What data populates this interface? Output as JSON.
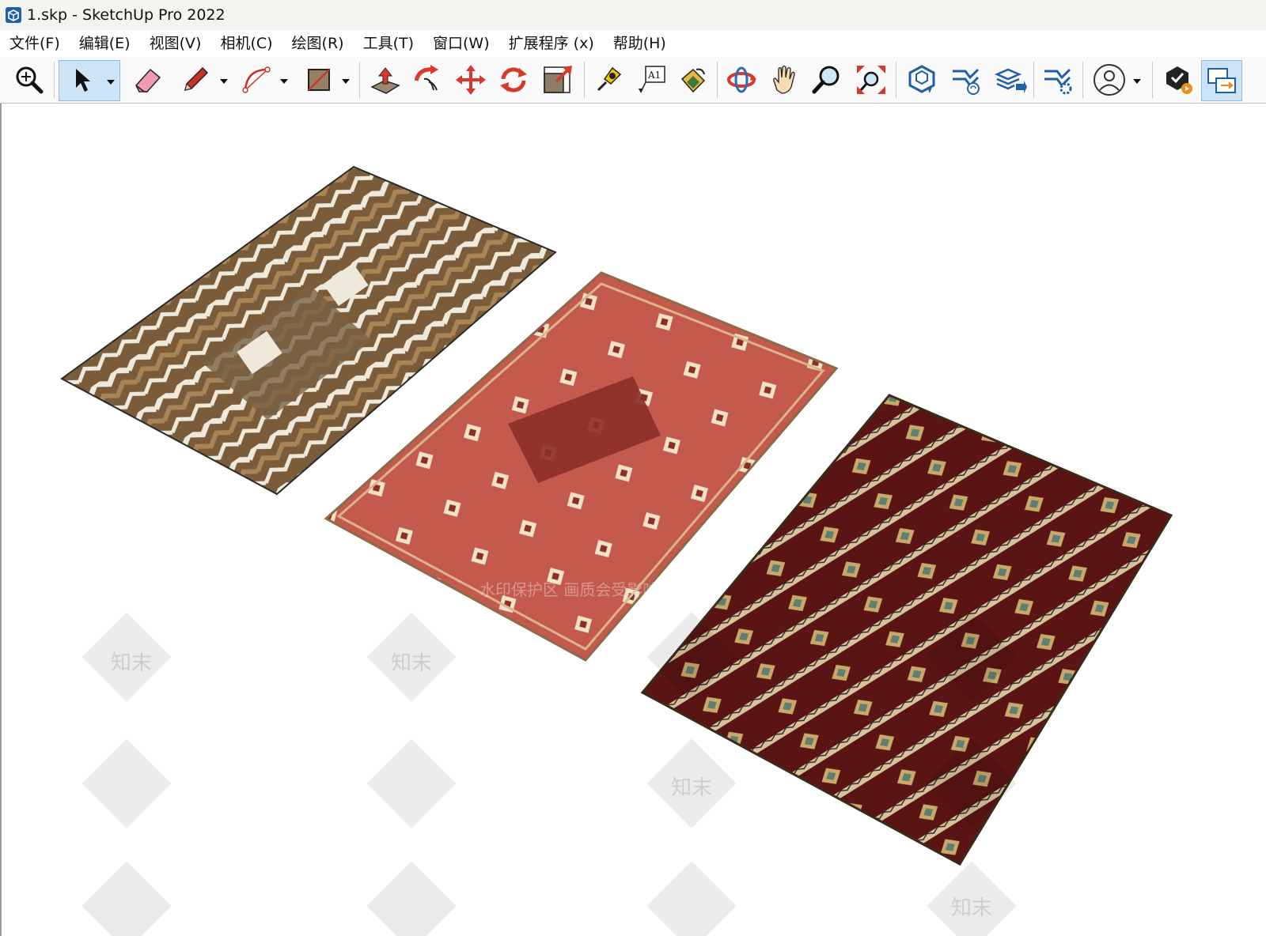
{
  "window": {
    "title": "1.skp - SketchUp Pro 2022"
  },
  "menubar": {
    "items": [
      {
        "label": "文件(F)"
      },
      {
        "label": "编辑(E)"
      },
      {
        "label": "视图(V)"
      },
      {
        "label": "相机(C)"
      },
      {
        "label": "绘图(R)"
      },
      {
        "label": "工具(T)"
      },
      {
        "label": "窗口(W)"
      },
      {
        "label": "扩展程序 (x)"
      },
      {
        "label": "帮助(H)"
      }
    ]
  },
  "toolbar": {
    "tools": [
      {
        "icon": "zoom-magnifier-icon"
      },
      {
        "icon": "select-arrow-icon",
        "active": true
      },
      {
        "icon": "eraser-icon"
      },
      {
        "icon": "pencil-line-icon"
      },
      {
        "icon": "arc-icon"
      },
      {
        "icon": "rectangle-shape-icon"
      },
      {
        "icon": "push-pull-icon"
      },
      {
        "icon": "follow-me-icon"
      },
      {
        "icon": "move-icon"
      },
      {
        "icon": "rotate-icon"
      },
      {
        "icon": "scale-icon"
      },
      {
        "icon": "tape-measure-icon"
      },
      {
        "icon": "text-label-icon",
        "text": "A1"
      },
      {
        "icon": "paint-bucket-icon"
      },
      {
        "icon": "orbit-icon"
      },
      {
        "icon": "pan-hand-icon"
      },
      {
        "icon": "zoom-icon"
      },
      {
        "icon": "zoom-extents-icon"
      },
      {
        "icon": "3d-warehouse-icon"
      },
      {
        "icon": "extension-warehouse-icon"
      },
      {
        "icon": "layout-send-icon"
      },
      {
        "icon": "extension-manager-icon"
      },
      {
        "icon": "account-profile-icon"
      },
      {
        "icon": "trimble-connect-icon"
      },
      {
        "icon": "sync-panel-icon"
      }
    ]
  },
  "viewport": {
    "watermark_overlay": "水印保护区  画质会受影响",
    "watermark_tile": "知末",
    "colors": {
      "rug1_brown": "#7a5b3a",
      "rug1_cream": "#efe9dc",
      "rug2_red": "#c45a4e",
      "rug2_dark": "#8c2d28",
      "rug3_maroon": "#5a1414",
      "rug3_tan": "#d8c29a"
    }
  }
}
